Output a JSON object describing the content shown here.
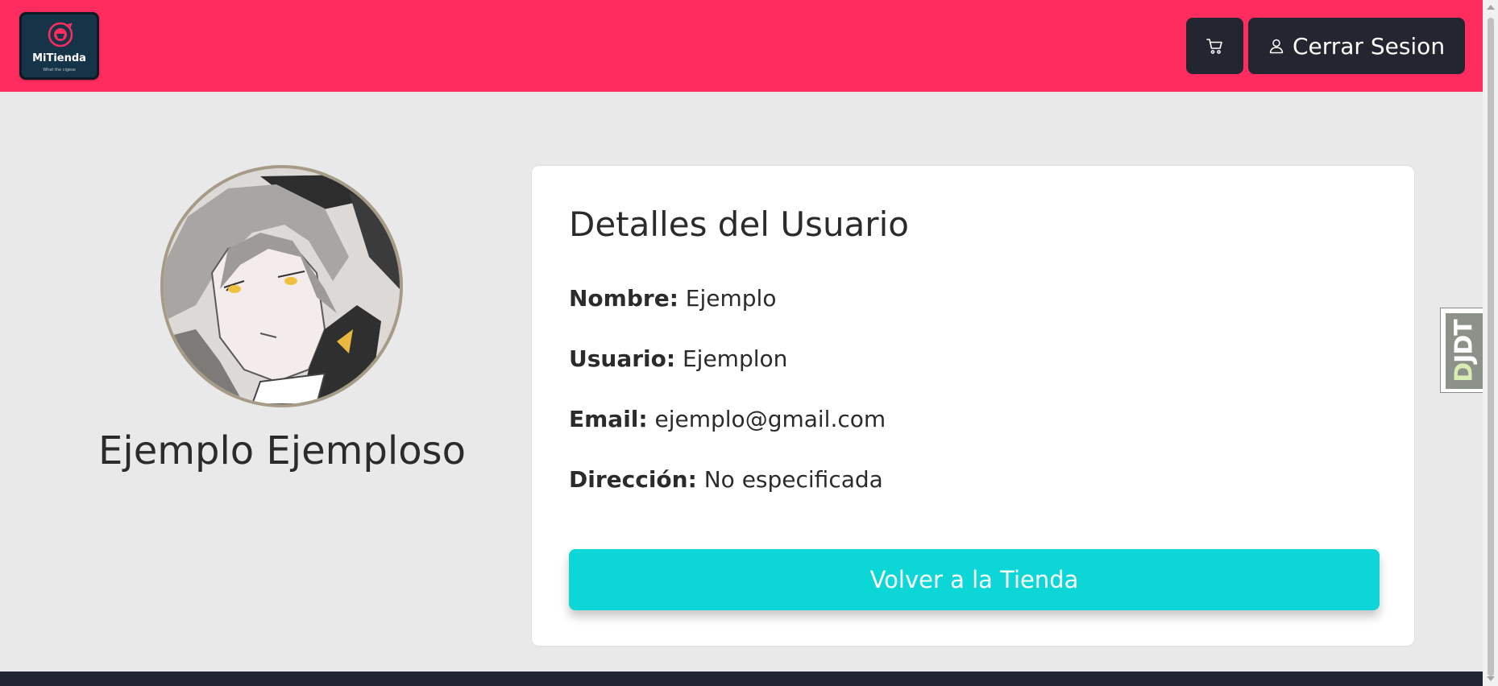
{
  "header": {
    "logo": {
      "name": "MiTienda",
      "tagline": "What the cigese"
    },
    "cart_icon": "cart-icon",
    "logout": {
      "icon": "user-icon",
      "label": "Cerrar Sesion"
    }
  },
  "profile": {
    "name": "Ejemplo Ejemploso",
    "avatar": "user-avatar"
  },
  "details": {
    "title": "Detalles del Usuario",
    "fields": [
      {
        "label": "Nombre:",
        "value": "Ejemplo"
      },
      {
        "label": "Usuario:",
        "value": "Ejemplon"
      },
      {
        "label": "Email:",
        "value": "ejemplo@gmail.com"
      },
      {
        "label": "Dirección:",
        "value": "No especificada"
      }
    ],
    "back_button": "Volver a la Tienda"
  },
  "debug_toolbar": {
    "first": "D",
    "rest": "JDT"
  },
  "colors": {
    "navbar": "#ff2d5f",
    "dark_button": "#232631",
    "accent": "#0dd6d6",
    "page_background": "#e9e9e9",
    "footer": "#222632"
  }
}
